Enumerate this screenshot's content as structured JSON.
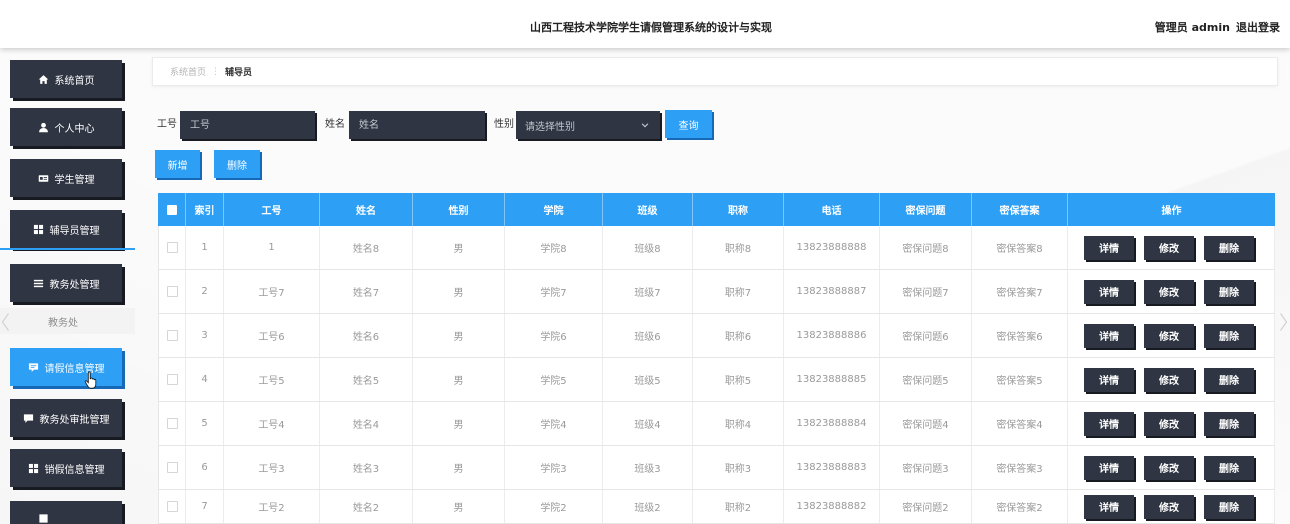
{
  "header": {
    "title": "山西工程技术学院学生请假管理系统的设计与实现",
    "user": "管理员 admin",
    "logout": "退出登录"
  },
  "sidebar": {
    "items": [
      {
        "label": "系统首页",
        "icon": "home-icon"
      },
      {
        "label": "个人中心",
        "icon": "user-icon"
      },
      {
        "label": "学生管理",
        "icon": "id-card-icon"
      },
      {
        "label": "辅导员管理",
        "icon": "grid-icon",
        "active": true
      },
      {
        "label": "教务处管理",
        "icon": "list-icon"
      },
      {
        "label": "请假信息管理",
        "icon": "message-icon",
        "highlighted": true
      },
      {
        "label": "教务处审批管理",
        "icon": "chat-icon"
      },
      {
        "label": "销假信息管理",
        "icon": "grid-icon"
      },
      {
        "label": "",
        "icon": "square-icon"
      }
    ],
    "submenu_item": "教务处"
  },
  "breadcrumb": {
    "home": "系统首页",
    "separator": "⋮",
    "current": "辅导员"
  },
  "search": {
    "job_no": {
      "label": "工号",
      "placeholder": "工号"
    },
    "name": {
      "label": "姓名",
      "placeholder": "姓名"
    },
    "gender": {
      "label": "性别",
      "placeholder": "请选择性别"
    },
    "query_button": "查询"
  },
  "actions": {
    "add": "新增",
    "delete": "删除"
  },
  "table": {
    "columns": [
      "索引",
      "工号",
      "姓名",
      "性别",
      "学院",
      "班级",
      "职称",
      "电话",
      "密保问题",
      "密保答案",
      "操作"
    ],
    "rows": [
      {
        "index": "1",
        "job_no": "1",
        "name": "姓名8",
        "gender": "男",
        "college": "学院8",
        "class_name": "班级8",
        "title": "职称8",
        "phone": "13823888888",
        "security_question": "密保问题8",
        "security_answer": "密保答案8"
      },
      {
        "index": "2",
        "job_no": "工号7",
        "name": "姓名7",
        "gender": "男",
        "college": "学院7",
        "class_name": "班级7",
        "title": "职称7",
        "phone": "13823888887",
        "security_question": "密保问题7",
        "security_answer": "密保答案7"
      },
      {
        "index": "3",
        "job_no": "工号6",
        "name": "姓名6",
        "gender": "男",
        "college": "学院6",
        "class_name": "班级6",
        "title": "职称6",
        "phone": "13823888886",
        "security_question": "密保问题6",
        "security_answer": "密保答案6"
      },
      {
        "index": "4",
        "job_no": "工号5",
        "name": "姓名5",
        "gender": "男",
        "college": "学院5",
        "class_name": "班级5",
        "title": "职称5",
        "phone": "13823888885",
        "security_question": "密保问题5",
        "security_answer": "密保答案5"
      },
      {
        "index": "5",
        "job_no": "工号4",
        "name": "姓名4",
        "gender": "男",
        "college": "学院4",
        "class_name": "班级4",
        "title": "职称4",
        "phone": "13823888884",
        "security_question": "密保问题4",
        "security_answer": "密保答案4"
      },
      {
        "index": "6",
        "job_no": "工号3",
        "name": "姓名3",
        "gender": "男",
        "college": "学院3",
        "class_name": "班级3",
        "title": "职称3",
        "phone": "13823888883",
        "security_question": "密保问题3",
        "security_answer": "密保答案3"
      },
      {
        "index": "7",
        "job_no": "工号2",
        "name": "姓名2",
        "gender": "男",
        "college": "学院2",
        "class_name": "班级2",
        "title": "职称2",
        "phone": "13823888882",
        "security_question": "密保问题2",
        "security_answer": "密保答案2"
      }
    ],
    "row_actions": {
      "detail": "详情",
      "edit": "修改",
      "delete": "删除"
    }
  },
  "colors": {
    "primary": "#2d9ff5",
    "dark": "#2f3542"
  }
}
